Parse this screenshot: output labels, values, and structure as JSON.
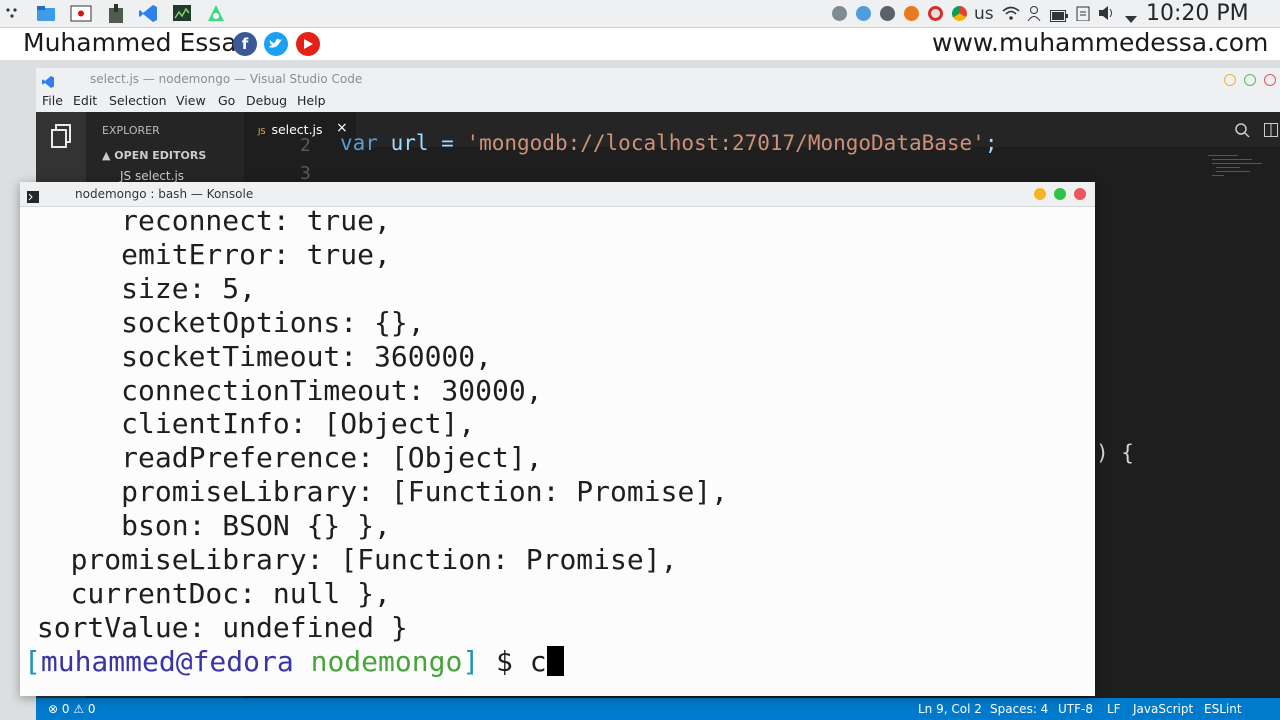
{
  "panel": {
    "keyboard_layout": "us",
    "clock": "10:20 PM"
  },
  "watermark": {
    "name": "Muhammed Essa",
    "url": "www.muhammedessa.com"
  },
  "vscode": {
    "window_title": "select.js — nodemongo — Visual Studio Code",
    "menu": [
      "File",
      "Edit",
      "Selection",
      "View",
      "Go",
      "Debug",
      "Help"
    ],
    "sidebar": {
      "explorer": "EXPLORER",
      "open_editors": "▲ OPEN EDITORS",
      "file": "JS select.js"
    },
    "tab": {
      "badge": "JS",
      "label": "select.js",
      "close": "×"
    },
    "editor": {
      "line2_number": "2",
      "line3_number": "3",
      "line2_keyword": "var",
      "line2_ident": " url = ",
      "line2_string": "'mongodb://localhost:27017/MongoDataBase'",
      "line2_end": ";",
      "brace": ") {"
    },
    "statusbar": {
      "problems": "⊗ 0 ⚠ 0",
      "position": "Ln 9, Col 2",
      "spaces": "Spaces: 4",
      "encoding": "UTF-8",
      "eol": "LF",
      "language": "JavaScript",
      "linter": "ESLint"
    }
  },
  "konsole": {
    "title": "nodemongo : bash — Konsole",
    "lines": [
      "      reconnect: true,",
      "      emitError: true,",
      "      size: 5,",
      "      socketOptions: {},",
      "      socketTimeout: 360000,",
      "      connectionTimeout: 30000,",
      "      clientInfo: [Object],",
      "      readPreference: [Object],",
      "      promiseLibrary: [Function: Promise],",
      "      bson: BSON {} },",
      "   promiseLibrary: [Function: Promise],",
      "   currentDoc: null },",
      " sortValue: undefined }"
    ],
    "prompt": {
      "open": "[",
      "user": "muhammed@fedora",
      "dir": "nodemongo",
      "close": "]",
      "symbol": " $ ",
      "input": "c"
    }
  },
  "colors": {
    "vscode_status": "#007acc",
    "prompt_user": "#3a35a5",
    "prompt_dir": "#47a53b",
    "close_dot": "#e95558",
    "max_dot": "#30c34a",
    "min_dot": "#f5b52b"
  }
}
